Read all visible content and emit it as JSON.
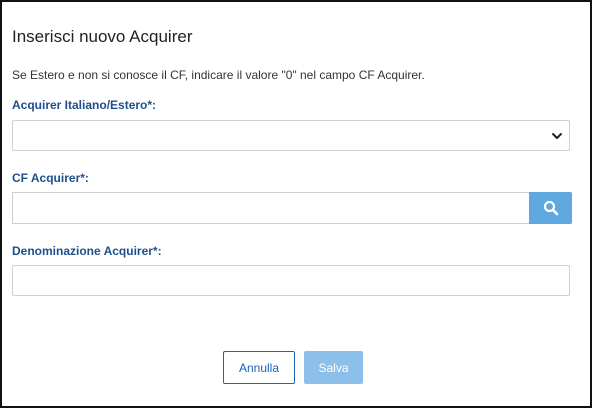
{
  "dialog": {
    "title": "Inserisci nuovo Acquirer",
    "hint": "Se Estero e non si conosce il CF, indicare il valore \"0\" nel campo CF Acquirer."
  },
  "fields": {
    "origin": {
      "label": "Acquirer Italiano/Estero*:",
      "selected": "",
      "icon": "chevron-down-icon"
    },
    "cf": {
      "label": "CF Acquirer*:",
      "value": "",
      "search_icon": "search-icon"
    },
    "name": {
      "label": "Denominazione Acquirer*:",
      "value": ""
    }
  },
  "buttons": {
    "cancel": "Annulla",
    "save": "Salva"
  },
  "colors": {
    "label": "#1d4f8c",
    "search_button": "#5fa7df",
    "save_button": "#8cc0ea",
    "cancel_border": "#1d64b5"
  }
}
